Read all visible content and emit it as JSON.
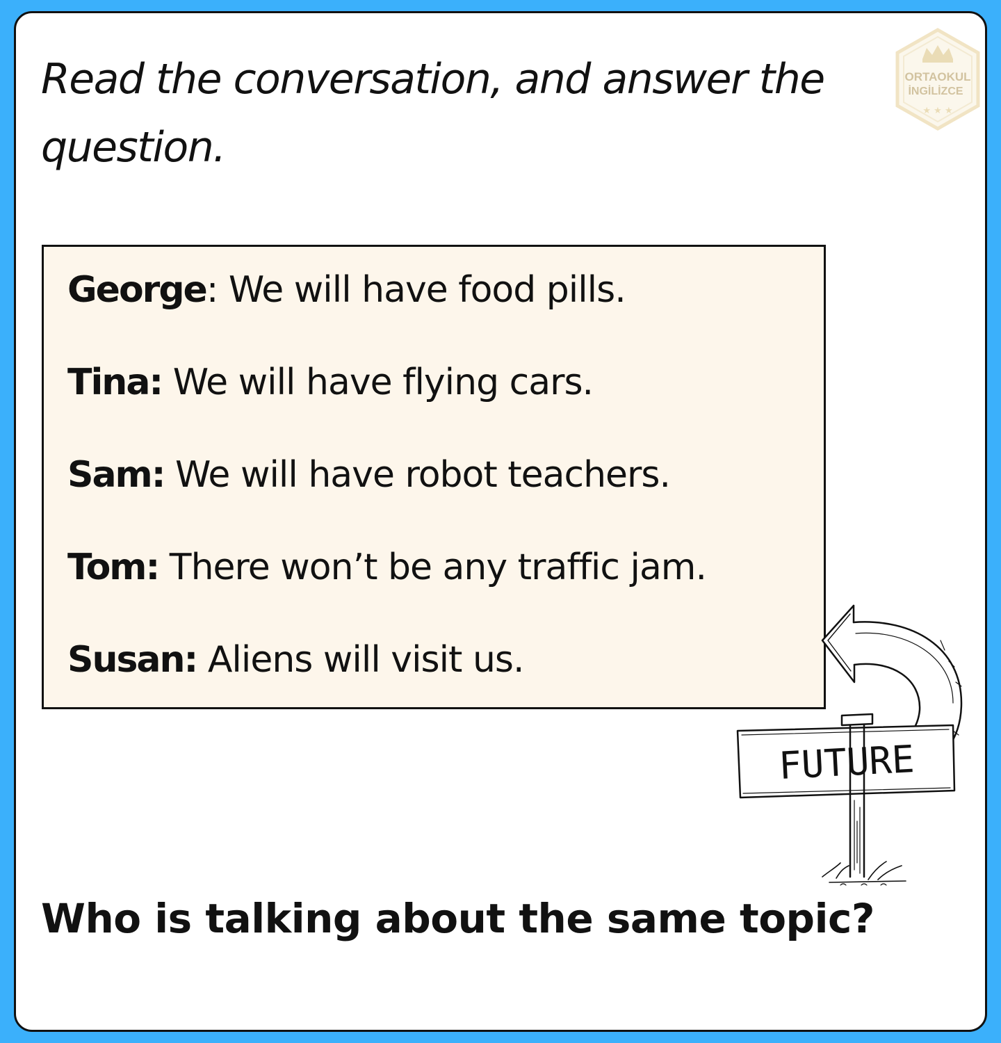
{
  "instruction": "Read the conversation, and answer the question.",
  "logo": {
    "line1": "ORTAOKUL",
    "line2": "İNGİLİZCE",
    "colors": {
      "frame": "#f1e4c4",
      "text": "#d2c3a0"
    }
  },
  "conversation": [
    {
      "speaker": "George",
      "separator": ":",
      "text": " We will have food pills."
    },
    {
      "speaker": "Tina",
      "separator": ":",
      "text": " We will have flying cars."
    },
    {
      "speaker": "Sam",
      "separator": ":",
      "text": " We will have robot teachers."
    },
    {
      "speaker": "Tom",
      "separator": ":",
      "text": " There won’t be any traffic jam."
    },
    {
      "speaker": "Susan",
      "separator": ":",
      "text": " Aliens will visit us."
    }
  ],
  "signpost": {
    "label": "FUTURE"
  },
  "question": "Who is talking about the same topic?",
  "colors": {
    "background": "#3bb0fb",
    "card": "#ffffff",
    "dialogue_box": "#fdf6eb",
    "text": "#111111"
  }
}
